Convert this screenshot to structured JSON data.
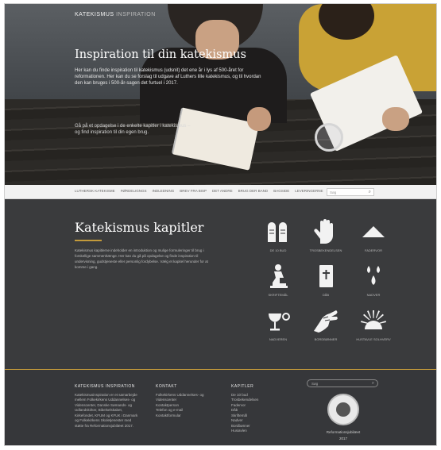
{
  "header": {
    "brand_bold": "KATEKISMUS",
    "brand_light": "INSPIRATION",
    "title": "Inspiration til din katekismus",
    "intro": "Her kan du finde inspiration til katekismus (udsnit) det ene år i lys af 500-året for reformationen. Her kan du se forslag til udgave af Luthers lille katekismus, og til hvordan den kan bruges i 500-år-sagen det furtuel i 2017.",
    "intro2": "Gå på et opdagelse i de enkelte kapitler i katekismus – og find inspiration til din egen brug."
  },
  "nav": {
    "items": [
      "LUTHERSK KATEKISME",
      "FØRDELIGNGS",
      "INDLEDNING",
      "BREV FRA BISP",
      "DET ANDRE",
      "BRUG DER BAND",
      "BAGSIDE",
      "LEVERINGERNE"
    ],
    "search_placeholder": "Søg"
  },
  "chapters": {
    "title": "Katekismus kapitler",
    "text": "Katekismus kapitlerne indeholder en introduktion og mulige formuleringer til brug i forskellige sammenhænge. Her kan du gå på opdagelse og finde inspiration til undervisning, gudstjeneste eller personlig fordybelse. Vælg et kapitel herunder for at komme i gang.",
    "items": [
      {
        "label": "DE 10 BUD",
        "icon": "tablets-icon"
      },
      {
        "label": "TROSBEKENDELSEN",
        "icon": "hand-icon"
      },
      {
        "label": "FADERVOR",
        "icon": "triangle-icon"
      },
      {
        "label": "SKRIFTEMÅL",
        "icon": "kneeling-icon"
      },
      {
        "label": "DÅB",
        "icon": "bible-icon"
      },
      {
        "label": "NADVER",
        "icon": "drops-icon"
      },
      {
        "label": "NADVEREN",
        "icon": "chalice-icon"
      },
      {
        "label": "BORDBØNNER",
        "icon": "blessing-hand-icon"
      },
      {
        "label": "HUSTAVLE SOLHVERV",
        "icon": "sunrise-icon"
      }
    ]
  },
  "footer": {
    "col1": {
      "title": "KATEKISMUS INSPIRATION",
      "lines": [
        "Katekismusinspiration er et samarbejde",
        "mellem Folkekirkens Uddannelses- og",
        "Videnscenter, Danske Sømands- og",
        "Udlandskirker, Bibelselskabet,",
        "Kirkefondet, KFUM og KFUK i Danmark",
        "og Folkekirkens Skoletjenester med",
        "støtte fra Reformationsjubilæet 2017."
      ]
    },
    "col2": {
      "title": "KONTAKT",
      "lines": [
        "Folkekirkens Uddannelses- og",
        "Videnscenter",
        "Kontaktperson",
        "Telefon og e-mail",
        "Kontaktformular"
      ]
    },
    "col3": {
      "title": "KAPITLER",
      "lines": [
        "De 10 bud",
        "Trosbekendelsen",
        "Fadervor",
        "Dåb",
        "Skriftemål",
        "Nadver",
        "Bordbønner",
        "Husiavlen"
      ]
    },
    "search_placeholder": "Søg",
    "seal_caption_1": "Reformationsjubilæet",
    "seal_caption_2": "2017"
  }
}
